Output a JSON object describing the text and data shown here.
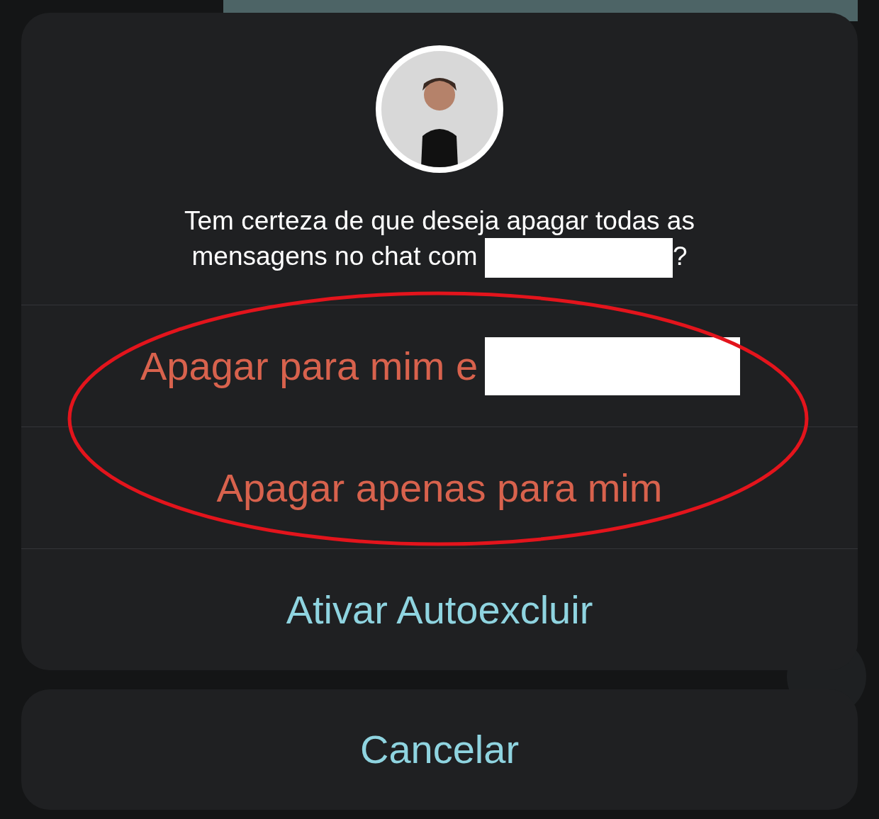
{
  "dialog": {
    "avatar": {
      "kind": "figure"
    },
    "message": [
      {
        "kind": "text",
        "text": "Tem certeza de que deseja apagar todas as mensagens no chat com"
      },
      {
        "kind": "redacted"
      },
      {
        "kind": "text",
        "text": "?"
      }
    ],
    "actions": [
      {
        "label": "Apagar para mim e",
        "destructive": true,
        "redacted": true
      },
      {
        "label": "Apagar apenas para mim",
        "destructive": true,
        "redacted": false
      },
      {
        "label": "Ativar Autoexcluir",
        "destructive": false,
        "redacted": false
      }
    ]
  },
  "cancel": {
    "label": "Cancelar"
  },
  "annotation": {
    "kind": "ellipse"
  }
}
